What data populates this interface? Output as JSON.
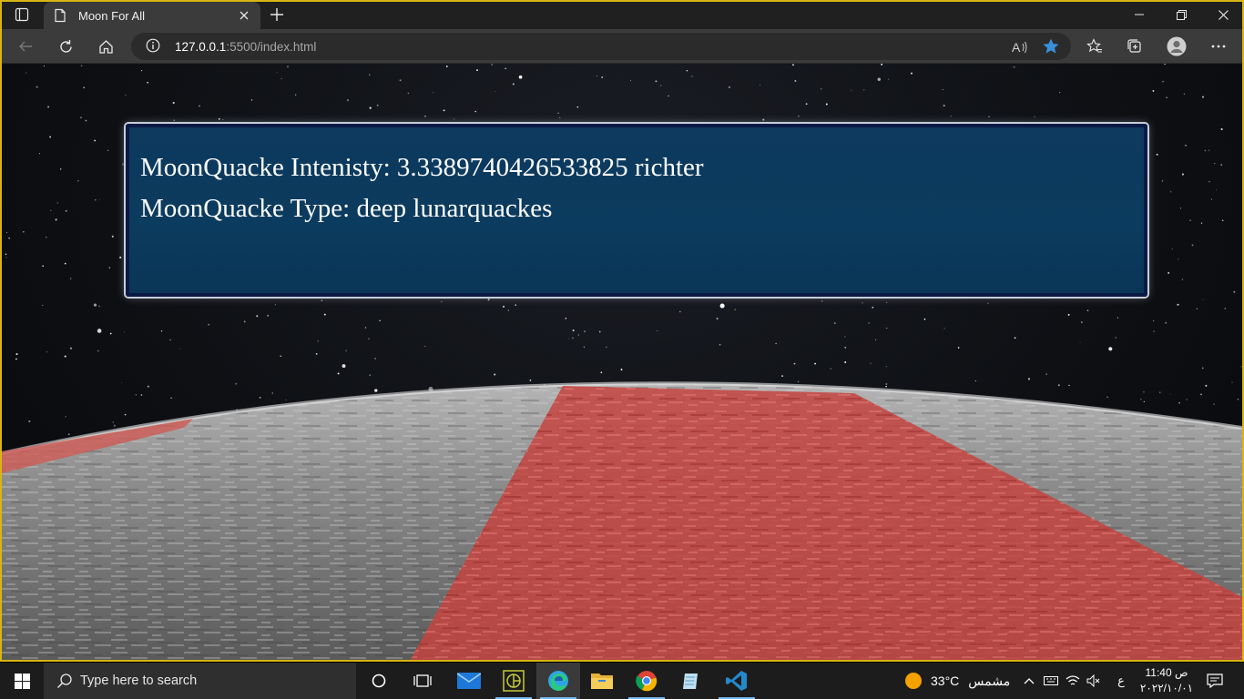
{
  "browser": {
    "tab_title": "Moon For All",
    "url_host": "127.0.0.1",
    "url_path": ":5500/index.html"
  },
  "page": {
    "intensity_text": "MoonQuacke Intenisty: 3.3389740426533825 richter",
    "type_text": "MoonQuacke Type: deep lunarquackes"
  },
  "taskbar": {
    "search_placeholder": "Type here to search",
    "weather_temp": "33°C",
    "weather_desc": "مشمس",
    "lang": "ع",
    "time": "11:40 ص",
    "date": "٢٠٢٢/١٠/٠١"
  },
  "colors": {
    "window_border": "#d9b514",
    "panel_bg": "#0b3b5e",
    "highlight_region": "#e0524f",
    "accent": "#3b8fd9"
  }
}
